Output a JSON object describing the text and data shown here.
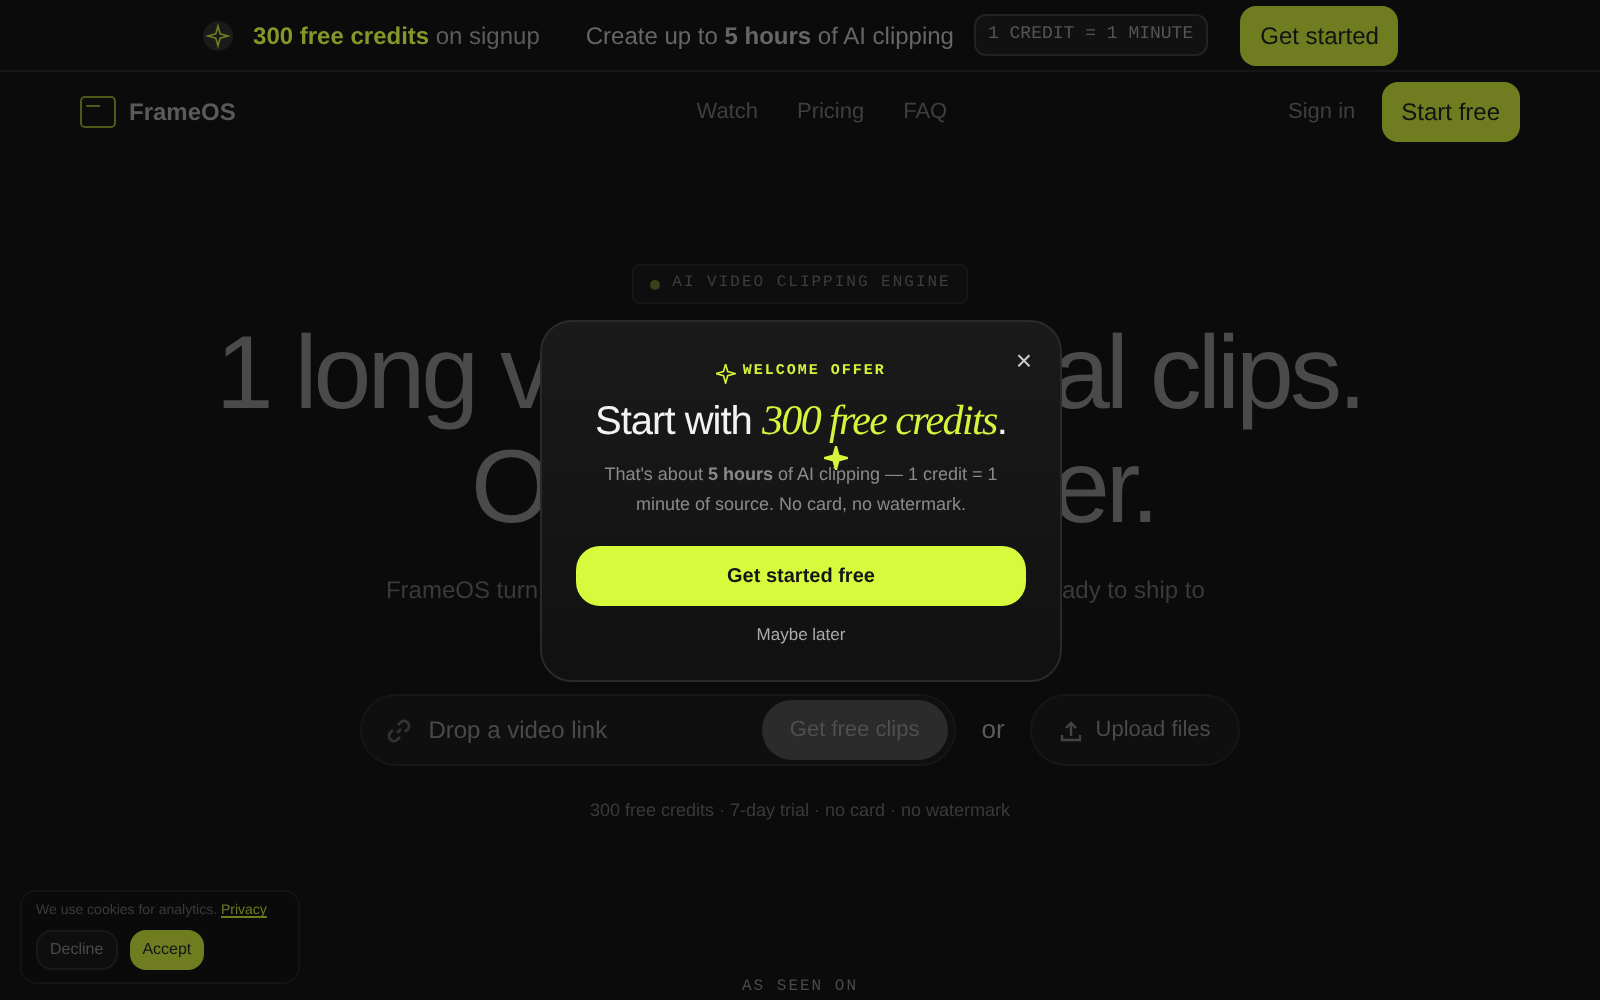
{
  "promo_bar": {
    "credits": "300 free credits",
    "credits_note": "on signup",
    "message": "Create up to **5 hours** of AI clipping",
    "rate_badge": "1 CREDIT = 1 MINUTE",
    "button": "Get started"
  },
  "nav": {
    "brand": "FrameOS",
    "links": [
      "Watch",
      "Pricing",
      "FAQ"
    ],
    "sign_in": "Sign in",
    "cta": "Start free"
  },
  "hero": {
    "eyebrow": "AI VIDEO CLIPPING ENGINE",
    "headline_lines": [
      {
        "left": "1 long v",
        "right": "al clips."
      },
      {
        "left": "O",
        "right": "er."
      }
    ],
    "subtitle": {
      "left": "FrameOS turn",
      "right": "ady to ship to"
    },
    "link_field": {
      "placeholder": "Drop a video link"
    },
    "submit": "Get free clips",
    "or": "or",
    "upload": "Upload files",
    "footnote": "300 free credits · 7-day trial · no card · no watermark"
  },
  "press": {
    "label": "AS SEEN ON"
  },
  "cookie_banner": {
    "text": "We use cookies for analytics.",
    "link": "Privacy",
    "decline": "Decline",
    "accept": "Accept"
  },
  "modal": {
    "eyebrow": "WELCOME OFFER",
    "title": "Start with *300 free credits*.",
    "body": "That's about **5 hours** of AI clipping — 1 credit = 1 minute of source. No card, no watermark.",
    "button": "Get started free",
    "dismiss": "Maybe later",
    "close": "×"
  }
}
